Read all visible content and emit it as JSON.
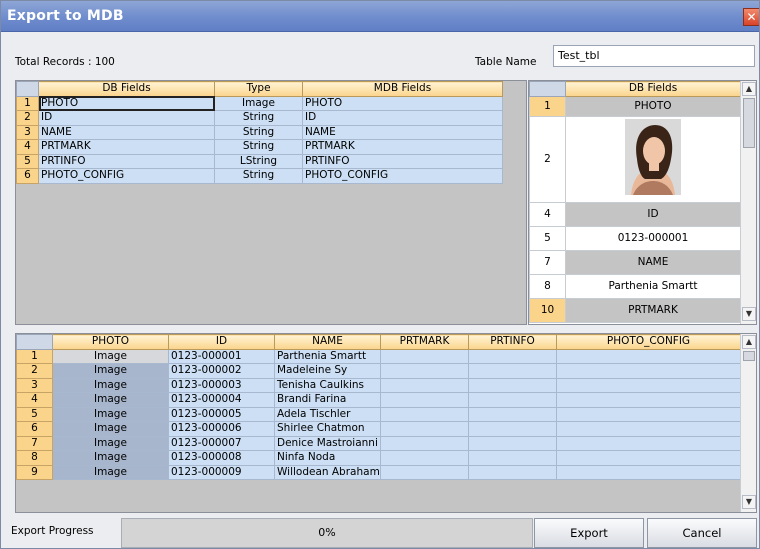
{
  "window": {
    "title": "Export to MDB",
    "close_glyph": "✕"
  },
  "total_records_label": "Total Records : 100",
  "table_name": {
    "label": "Table Name",
    "value": "Test_tbl"
  },
  "fields_grid": {
    "headers": [
      "DB Fields",
      "Type",
      "MDB Fields"
    ],
    "rows": [
      {
        "num": "1",
        "db": "PHOTO",
        "type": "Image",
        "mdb": "PHOTO"
      },
      {
        "num": "2",
        "db": "ID",
        "type": "String",
        "mdb": "ID"
      },
      {
        "num": "3",
        "db": "NAME",
        "type": "String",
        "mdb": "NAME"
      },
      {
        "num": "4",
        "db": "PRTMARK",
        "type": "String",
        "mdb": "PRTMARK"
      },
      {
        "num": "5",
        "db": "PRTINFO",
        "type": "LString",
        "mdb": "PRTINFO"
      },
      {
        "num": "6",
        "db": "PHOTO_CONFIG",
        "type": "String",
        "mdb": "PHOTO_CONFIG"
      }
    ]
  },
  "preview_grid": {
    "header": "DB Fields",
    "rows": [
      {
        "num": "1",
        "value": "PHOTO",
        "kind": "label"
      },
      {
        "num": "2",
        "value": "",
        "kind": "photo"
      },
      {
        "num": "4",
        "value": "ID",
        "kind": "label"
      },
      {
        "num": "5",
        "value": "0123-000001",
        "kind": "value"
      },
      {
        "num": "7",
        "value": "NAME",
        "kind": "label"
      },
      {
        "num": "8",
        "value": "Parthenia Smartt",
        "kind": "value"
      },
      {
        "num": "10",
        "value": "PRTMARK",
        "kind": "label"
      }
    ]
  },
  "data_grid": {
    "headers": [
      "PHOTO",
      "ID",
      "NAME",
      "PRTMARK",
      "PRTINFO",
      "PHOTO_CONFIG"
    ],
    "rows": [
      {
        "num": "1",
        "photo": "Image",
        "id": "0123-000001",
        "name": "Parthenia Smartt"
      },
      {
        "num": "2",
        "photo": "Image",
        "id": "0123-000002",
        "name": "Madeleine Sy"
      },
      {
        "num": "3",
        "photo": "Image",
        "id": "0123-000003",
        "name": "Tenisha Caulkins"
      },
      {
        "num": "4",
        "photo": "Image",
        "id": "0123-000004",
        "name": "Brandi Farina"
      },
      {
        "num": "5",
        "photo": "Image",
        "id": "0123-000005",
        "name": "Adela Tischler"
      },
      {
        "num": "6",
        "photo": "Image",
        "id": "0123-000006",
        "name": "Shirlee Chatmon"
      },
      {
        "num": "7",
        "photo": "Image",
        "id": "0123-000007",
        "name": "Denice Mastroianni"
      },
      {
        "num": "8",
        "photo": "Image",
        "id": "0123-000008",
        "name": "Ninfa Noda"
      },
      {
        "num": "9",
        "photo": "Image",
        "id": "0123-000009",
        "name": "Willodean Abrahams"
      }
    ]
  },
  "footer": {
    "progress_label": "Export Progress",
    "progress_text": "0%",
    "progress_value": 0,
    "export_label": "Export",
    "cancel_label": "Cancel"
  },
  "icons": {
    "scroll_up": "scroll-up-arrow-icon",
    "scroll_down": "scroll-down-arrow-icon",
    "close": "close-icon"
  },
  "colors": {
    "title_bar": "#6f8ccd",
    "header": "#fbd48b",
    "cell": "#ccdff4",
    "preview_label": "#c4c4c4"
  }
}
